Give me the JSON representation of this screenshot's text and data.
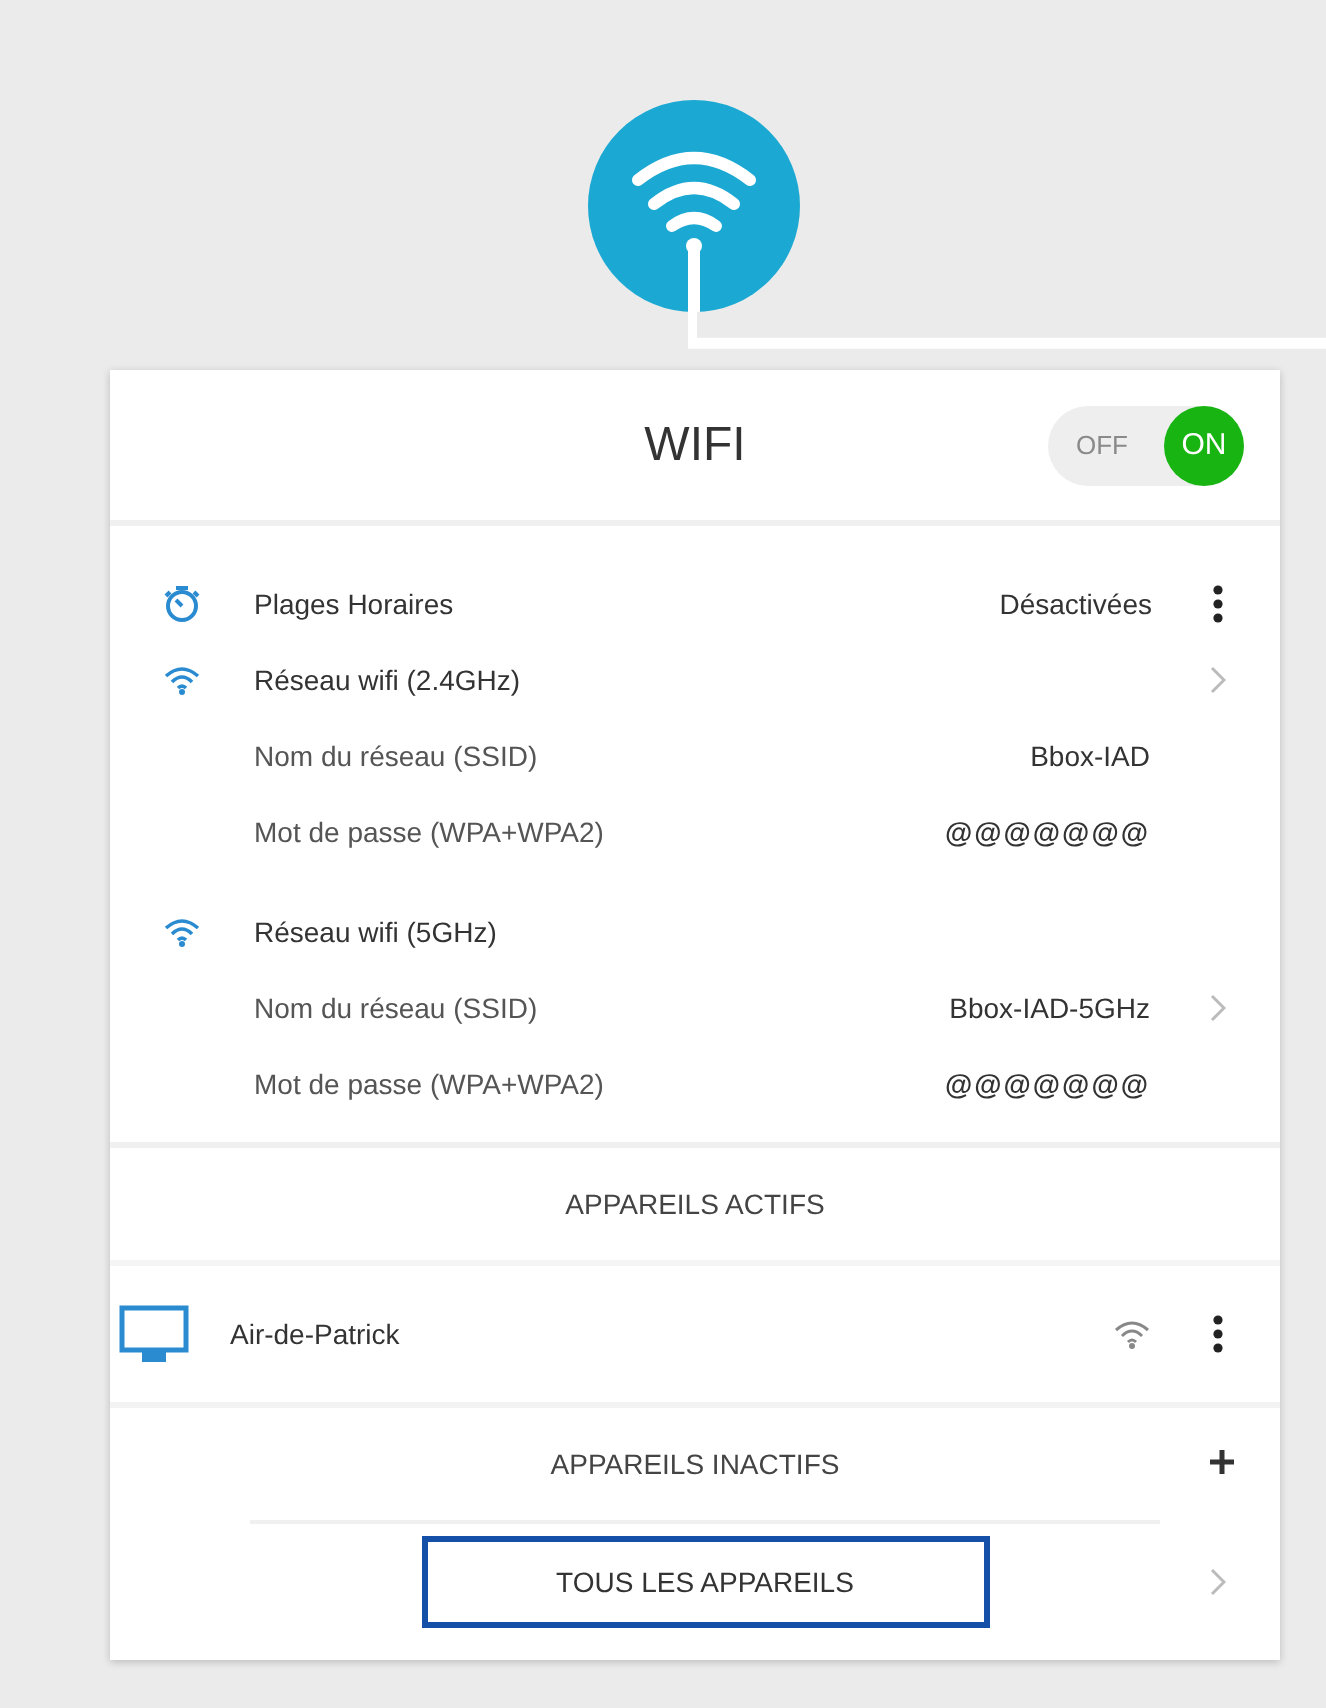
{
  "header": {
    "title": "WIFI",
    "toggle": {
      "off_label": "OFF",
      "on_label": "ON",
      "on": true
    }
  },
  "schedule": {
    "label": "Plages Horaires",
    "value": "Désactivées"
  },
  "networks": [
    {
      "title": "Réseau wifi (2.4GHz)",
      "fields": [
        {
          "label": "Nom du réseau (SSID)",
          "value": "Bbox-IAD"
        },
        {
          "label": "Mot de passe (WPA+WPA2)",
          "value": "@@@@@@@"
        }
      ]
    },
    {
      "title": "Réseau wifi (5GHz)",
      "fields": [
        {
          "label": "Nom du réseau (SSID)",
          "value": "Bbox-IAD-5GHz"
        },
        {
          "label": "Mot de passe (WPA+WPA2)",
          "value": "@@@@@@@"
        }
      ]
    }
  ],
  "active_devices": {
    "title": "APPAREILS ACTIFS",
    "items": [
      {
        "name": "Air-de-Patrick",
        "kind": "wifi"
      }
    ]
  },
  "inactive_devices": {
    "title": "APPAREILS INACTIFS"
  },
  "all_devices_button": "TOUS LES APPAREILS"
}
